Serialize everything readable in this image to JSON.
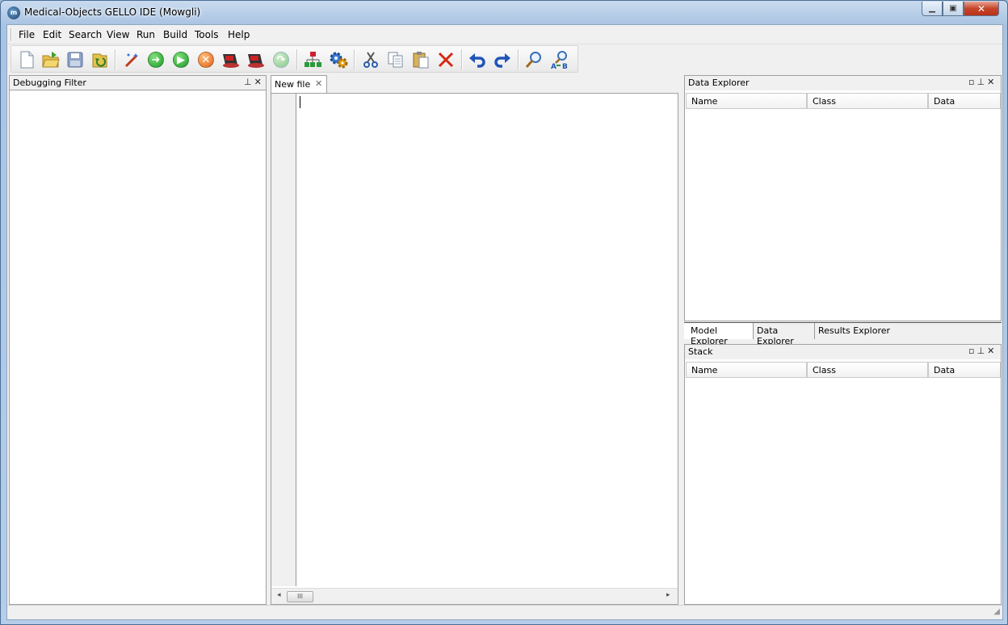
{
  "window": {
    "title": "Medical-Objects GELLO IDE (Mowgli)",
    "app_icon_text": "m"
  },
  "menu": [
    "File",
    "Edit",
    "Search",
    "View",
    "Run",
    "Build",
    "Tools",
    "Help"
  ],
  "toolbar": {
    "icons": [
      "new-file-icon",
      "open-file-icon",
      "save-icon",
      "revert-icon",
      "wizard-icon",
      "go-icon",
      "run-icon",
      "stop-icon",
      "debug-icon",
      "debug-step-icon",
      "step-over-icon",
      "model-tree-icon",
      "build-settings-icon",
      "cut-icon",
      "copy-icon",
      "paste-icon",
      "delete-icon",
      "undo-icon",
      "redo-icon",
      "find-icon",
      "replace-icon"
    ]
  },
  "left_panel": {
    "title": "Debugging Filter"
  },
  "editor": {
    "tab_label": "New file",
    "scroll_grip": "III"
  },
  "data_explorer": {
    "title": "Data Explorer",
    "columns": [
      "Name",
      "Class",
      "Data"
    ]
  },
  "explorer_tabs": [
    "Model Explorer",
    "Data Explorer",
    "Results Explorer"
  ],
  "stack": {
    "title": "Stack",
    "columns": [
      "Name",
      "Class",
      "Data"
    ]
  },
  "panel_controls": {
    "float": "▫",
    "pin": "⊥",
    "close": "✕"
  }
}
